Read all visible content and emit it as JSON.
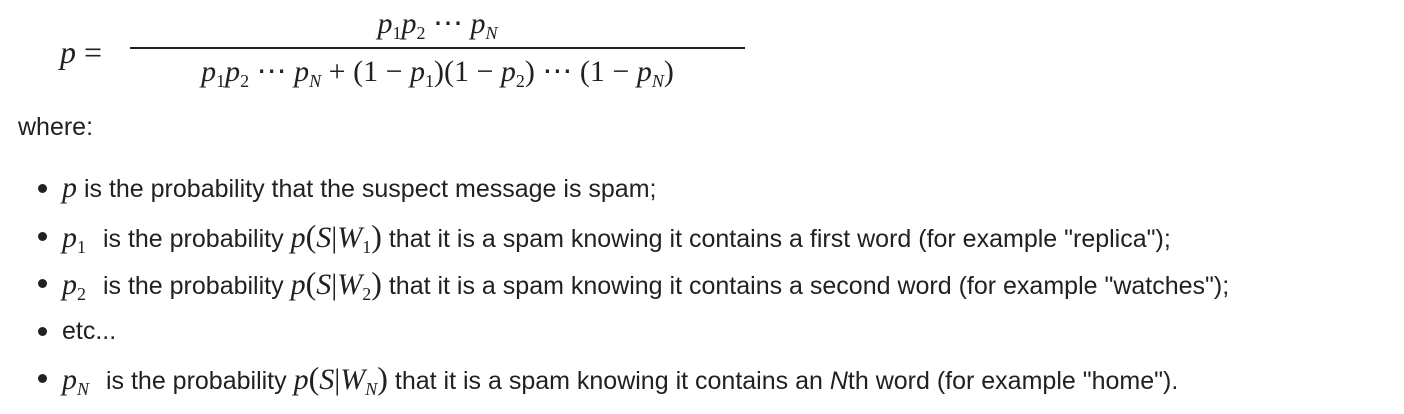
{
  "formula": {
    "lhs": "p =",
    "numerator": "p₁p₂ ⋯ p_N",
    "denominator": "p₁p₂ ⋯ p_N + (1 − p₁)(1 − p₂) ⋯ (1 − p_N)"
  },
  "where_label": "where:",
  "definitions": [
    {
      "symbol": "p",
      "sub": "",
      "text": "is the probability that the suspect message is spam;"
    },
    {
      "symbol": "p",
      "sub": "1",
      "prefix": "is the probability",
      "cond_sub": "1",
      "text": "that it is a spam knowing it contains a first word (for example \"replica\");"
    },
    {
      "symbol": "p",
      "sub": "2",
      "prefix": "is the probability",
      "cond_sub": "2",
      "text": "that it is a spam knowing it contains a second word (for example \"watches\");"
    },
    {
      "text": "etc..."
    },
    {
      "symbol": "p",
      "sub": "N",
      "prefix": "is the probability",
      "cond_sub": "N",
      "text_before_N": "that it is a spam knowing it contains an",
      "nth": "N",
      "text_after_N": "th word (for example \"home\")."
    }
  ]
}
